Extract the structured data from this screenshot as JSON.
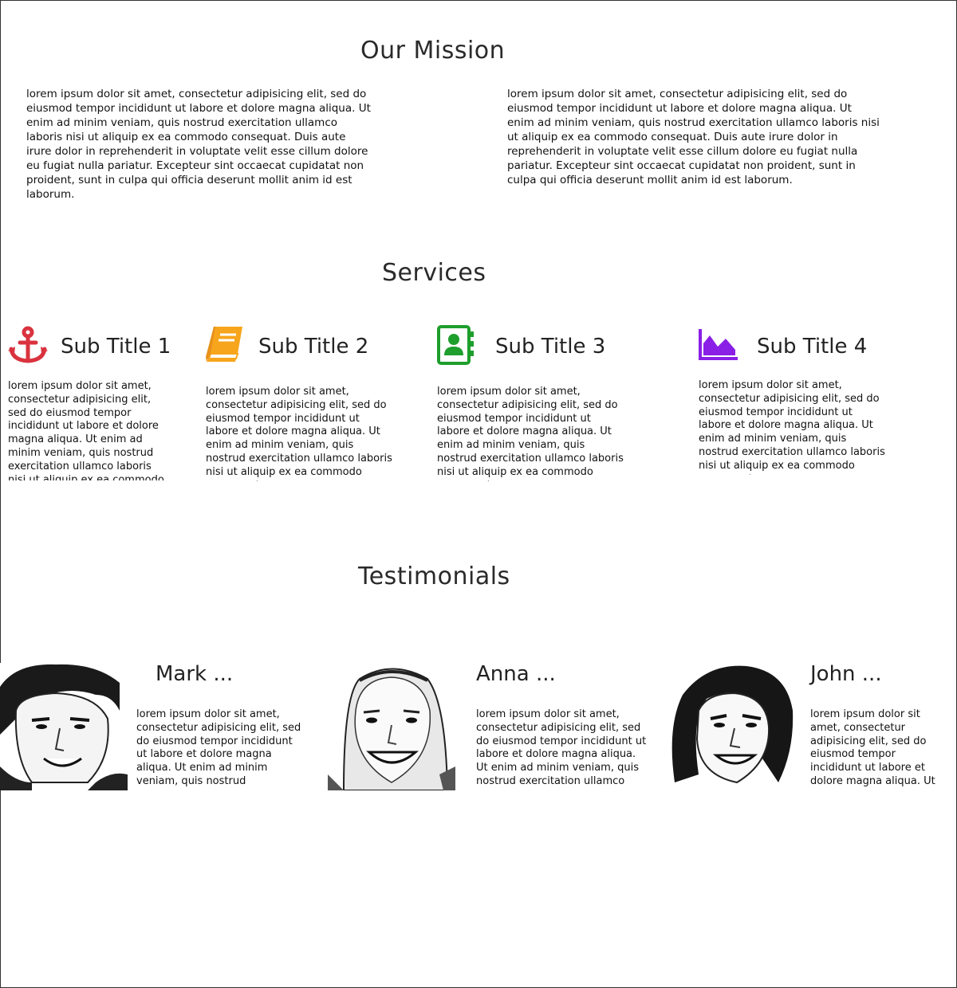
{
  "mission": {
    "title": "Our Mission",
    "paragraph_left": "lorem ipsum dolor sit amet, consectetur adipisicing elit, sed do eiusmod tempor incididunt ut labore et dolore magna aliqua. Ut  enim ad minim veniam, quis nostrud exercitation ullamco laboris nisi ut aliquip ex ea commodo consequat. Duis aute irure dolor in reprehenderit in voluptate velit esse cillum dolore eu fugiat nulla pariatur. Excepteur sint occaecat cupidatat non proident, sunt in culpa qui officia deserunt mollit anim id est laborum.",
    "paragraph_right": "lorem ipsum dolor sit amet, consectetur adipisicing elit, sed do eiusmod tempor incididunt ut labore et dolore magna aliqua. Ut enim ad minim veniam, quis nostrud exercitation ullamco laboris nisi ut aliquip ex ea commodo consequat. Duis aute irure dolor in reprehenderit in voluptate velit esse cillum dolore eu fugiat nulla pariatur. Excepteur sint occaecat cupidatat non proident, sunt in culpa qui officia deserunt mollit anim id est laborum."
  },
  "services": {
    "title": "Services",
    "items": [
      {
        "title": "Sub Title 1",
        "icon": "anchor-icon",
        "color": "#d9333f",
        "text": "lorem ipsum dolor sit amet, consectetur adipisicing elit, sed do eiusmod tempor incididunt ut labore et dolore magna aliqua. Ut enim ad minim veniam, quis nostrud exercitation ullamco laboris nisi ut aliquip ex ea commodo consequat."
      },
      {
        "title": "Sub Title 2",
        "icon": "book-icon",
        "color": "#f7a51c",
        "text": "lorem ipsum dolor sit amet, consectetur adipisicing elit, sed do eiusmod tempor incididunt ut labore et dolore magna aliqua. Ut enim ad minim veniam, quis nostrud exercitation ullamco laboris nisi ut aliquip ex ea commodo consequat."
      },
      {
        "title": "Sub Title 3",
        "icon": "contact-book-icon",
        "color": "#1e9e2c",
        "text": "lorem ipsum dolor sit amet, consectetur adipisicing elit, sed do eiusmod tempor incididunt ut labore et dolore magna aliqua. Ut enim ad minim veniam, quis nostrud exercitation ullamco laboris nisi ut aliquip ex ea commodo consequat."
      },
      {
        "title": "Sub Title 4",
        "icon": "area-chart-icon",
        "color": "#8a1fe6",
        "text": "lorem ipsum dolor sit amet, consectetur adipisicing elit, sed do eiusmod tempor incididunt ut labore et dolore magna aliqua. Ut enim ad minim veniam, quis nostrud exercitation ullamco laboris nisi ut aliquip ex ea commodo consequat."
      }
    ]
  },
  "testimonials": {
    "title": "Testimonials",
    "items": [
      {
        "name": "Mark ...",
        "icon": "portrait-mark",
        "text": "lorem ipsum dolor sit amet, consectetur adipisicing elit, sed do eiusmod tempor incididunt ut labore et dolore magna aliqua. Ut enim ad minim veniam, quis nostrud exercitation ullamco"
      },
      {
        "name": "Anna ...",
        "icon": "portrait-anna",
        "text": "lorem ipsum dolor sit amet, consectetur adipisicing elit, sed do eiusmod tempor incididunt ut labore et dolore magna aliqua. Ut enim ad minim veniam, quis nostrud exercitation ullamco"
      },
      {
        "name": "John ...",
        "icon": "portrait-john",
        "text": "lorem ipsum dolor sit amet, consectetur adipisicing elit, sed do eiusmod tempor incididunt ut labore et dolore magna aliqua. Ut enim ad minim"
      }
    ]
  }
}
